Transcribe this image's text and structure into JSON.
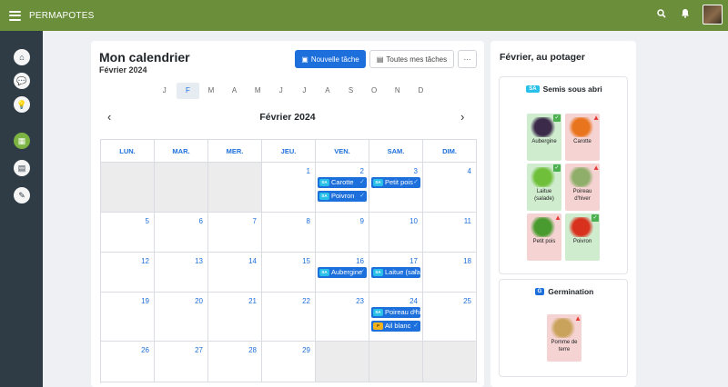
{
  "app": {
    "name": "PERMAPOTES"
  },
  "topbar": {
    "search_icon": "search-icon",
    "bell_icon": "bell-icon"
  },
  "sidebar": {
    "items": [
      {
        "name": "home",
        "icon": "house-icon",
        "glyph": "⌂"
      },
      {
        "name": "chat",
        "icon": "chat-icon",
        "glyph": "💬"
      },
      {
        "name": "ideas",
        "icon": "lightbulb-icon",
        "glyph": "💡"
      },
      {
        "name": "calendar",
        "icon": "calendar-icon",
        "glyph": "▦",
        "active": true
      },
      {
        "name": "map",
        "icon": "map-icon",
        "glyph": "▤"
      },
      {
        "name": "tools",
        "icon": "shovel-icon",
        "glyph": "✎"
      }
    ]
  },
  "calendar_page": {
    "title": "Mon calendrier",
    "subtitle": "Février 2024",
    "new_task_label": "Nouvelle tâche",
    "all_tasks_label": "Toutes mes tâches",
    "more_label": "···",
    "months": [
      "J",
      "F",
      "M",
      "A",
      "M",
      "J",
      "J",
      "A",
      "S",
      "O",
      "N",
      "D"
    ],
    "active_month_index": 1,
    "prev_label": "‹",
    "next_label": "›",
    "month_title": "Février 2024",
    "weekdays": [
      "LUN.",
      "MAR.",
      "MER.",
      "JEU.",
      "VEN.",
      "SAM.",
      "DIM."
    ],
    "weeks": [
      [
        {
          "day": "",
          "other": true
        },
        {
          "day": "",
          "other": true
        },
        {
          "day": "",
          "other": true
        },
        {
          "day": "1"
        },
        {
          "day": "2",
          "events": [
            {
              "badge": "SA",
              "type": "sa",
              "label": "Carotte"
            },
            {
              "badge": "SA",
              "type": "sa",
              "label": "Poivron"
            }
          ]
        },
        {
          "day": "3",
          "events": [
            {
              "badge": "SA",
              "type": "sa",
              "label": "Petit pois"
            }
          ]
        },
        {
          "day": "4"
        }
      ],
      [
        {
          "day": "5"
        },
        {
          "day": "6"
        },
        {
          "day": "7"
        },
        {
          "day": "8"
        },
        {
          "day": "9"
        },
        {
          "day": "10"
        },
        {
          "day": "11"
        }
      ],
      [
        {
          "day": "12"
        },
        {
          "day": "13"
        },
        {
          "day": "14"
        },
        {
          "day": "15"
        },
        {
          "day": "16",
          "events": [
            {
              "badge": "SA",
              "type": "sa",
              "label": "Aubergine"
            }
          ]
        },
        {
          "day": "17",
          "events": [
            {
              "badge": "SA",
              "type": "sa",
              "label": "Laitue (salade)"
            }
          ]
        },
        {
          "day": "18"
        }
      ],
      [
        {
          "day": "19"
        },
        {
          "day": "20"
        },
        {
          "day": "21"
        },
        {
          "day": "22"
        },
        {
          "day": "23"
        },
        {
          "day": "24",
          "events": [
            {
              "badge": "SA",
              "type": "sa",
              "label": "Poireau d'hiver"
            },
            {
              "badge": "P",
              "type": "pl",
              "label": "Ail blanc"
            }
          ]
        },
        {
          "day": "25"
        }
      ],
      [
        {
          "day": "26"
        },
        {
          "day": "27"
        },
        {
          "day": "28"
        },
        {
          "day": "29"
        },
        {
          "day": "",
          "other": true
        },
        {
          "day": "",
          "other": true
        },
        {
          "day": "",
          "other": true
        }
      ]
    ]
  },
  "potager": {
    "title": "Février, au potager",
    "sections": [
      {
        "badge": "SA",
        "type": "sa",
        "title": "Semis sous abri",
        "plants": [
          {
            "name": "Aubergine",
            "status": "ok",
            "color": "#3b2a4a"
          },
          {
            "name": "Carotte",
            "status": "warn",
            "color": "#e8741e"
          },
          {
            "name": "Laitue (salade)",
            "status": "ok",
            "color": "#6fbf3a"
          },
          {
            "name": "Poireau d'hiver",
            "status": "warn",
            "color": "#8fae6a"
          },
          {
            "name": "Petit pois",
            "status": "warn",
            "color": "#4a9b2f"
          },
          {
            "name": "Poivron",
            "status": "ok",
            "color": "#d8321f"
          }
        ]
      },
      {
        "badge": "G",
        "type": "g",
        "title": "Germination",
        "plants": [
          {
            "name": "Pomme de terre",
            "status": "warn",
            "color": "#c9a35c"
          }
        ]
      }
    ]
  },
  "colors": {
    "brand": "#6b8e3a",
    "accent": "#1d6fdc",
    "sidebar": "#2f3b45"
  }
}
